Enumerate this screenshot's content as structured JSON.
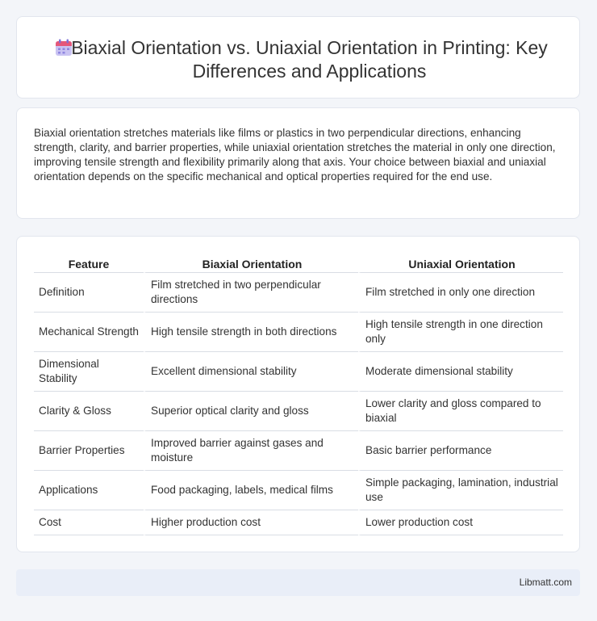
{
  "header": {
    "title": "Biaxial Orientation vs. Uniaxial Orientation in Printing: Key Differences and Applications",
    "icon": "calendar-icon"
  },
  "intro": {
    "text": "Biaxial orientation stretches materials like films or plastics in two perpendicular directions, enhancing strength, clarity, and barrier properties, while uniaxial orientation stretches the material in only one direction, improving tensile strength and flexibility primarily along that axis. Your choice between biaxial and uniaxial orientation depends on the specific mechanical and optical properties required for the end use."
  },
  "table": {
    "headers": [
      "Feature",
      "Biaxial Orientation",
      "Uniaxial Orientation"
    ],
    "rows": [
      [
        "Definition",
        "Film stretched in two perpendicular directions",
        "Film stretched in only one direction"
      ],
      [
        "Mechanical Strength",
        "High tensile strength in both directions",
        "High tensile strength in one direction only"
      ],
      [
        "Dimensional Stability",
        "Excellent dimensional stability",
        "Moderate dimensional stability"
      ],
      [
        "Clarity & Gloss",
        "Superior optical clarity and gloss",
        "Lower clarity and gloss compared to biaxial"
      ],
      [
        "Barrier Properties",
        "Improved barrier against gases and moisture",
        "Basic barrier performance"
      ],
      [
        "Applications",
        "Food packaging, labels, medical films",
        "Simple packaging, lamination, industrial use"
      ],
      [
        "Cost",
        "Higher production cost",
        "Lower production cost"
      ]
    ]
  },
  "footer": {
    "text": "Libmatt.com"
  }
}
